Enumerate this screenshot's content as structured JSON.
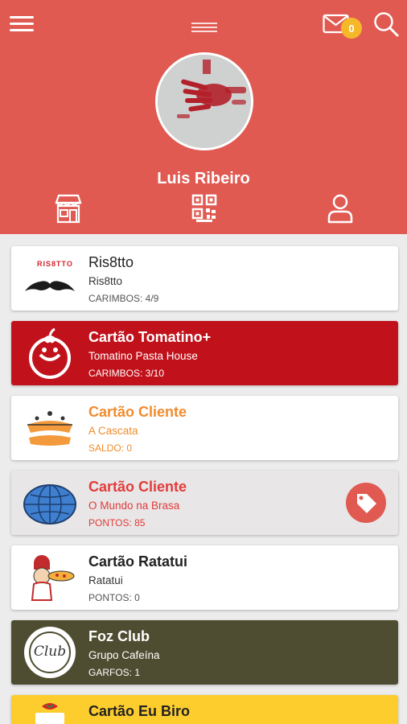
{
  "header": {
    "menu_icon": "hamburger-icon",
    "drag_icon": "drag-handle-icon",
    "mail_icon": "mail-icon",
    "notifications_count": "0",
    "search_icon": "search-icon",
    "user_name": "Luis Ribeiro",
    "nav": [
      "store-icon",
      "qr-code-icon",
      "profile-icon"
    ]
  },
  "cards": [
    {
      "title": "Ris8tto",
      "subtitle": "Ris8tto",
      "meta": "CARIMBOS: 4/9",
      "logo_text": "RIS8TTO",
      "bg": "#ffffff",
      "title_color": "#222222"
    },
    {
      "title": "Cartão Tomatino+",
      "subtitle": "Tomatino Pasta House",
      "meta": "CARIMBOS: 3/10",
      "bg": "#c1121b",
      "title_color": "#ffffff"
    },
    {
      "title": "Cartão Cliente",
      "subtitle": "A Cascata",
      "meta": "SALDO: 0",
      "bg": "#ffffff",
      "title_color": "#f08c2d"
    },
    {
      "title": "Cartão Cliente",
      "subtitle": "O Mundo na Brasa",
      "meta": "PONTOS: 85",
      "bg": "#e8e6e6",
      "title_color": "#e33b3b",
      "tag_icon": "price-tag-icon"
    },
    {
      "title": "Cartão Ratatui",
      "subtitle": "Ratatui",
      "meta": "PONTOS: 0",
      "bg": "#ffffff",
      "title_color": "#222222"
    },
    {
      "title": "Foz Club",
      "subtitle": "Grupo Cafeína",
      "meta": "GARFOS: 1",
      "logo_text": "Club",
      "bg": "#4f4d31",
      "title_color": "#ffffff"
    },
    {
      "title": "Cartão Eu Biro",
      "bg": "#fdcd2e",
      "title_color": "#222222"
    }
  ]
}
